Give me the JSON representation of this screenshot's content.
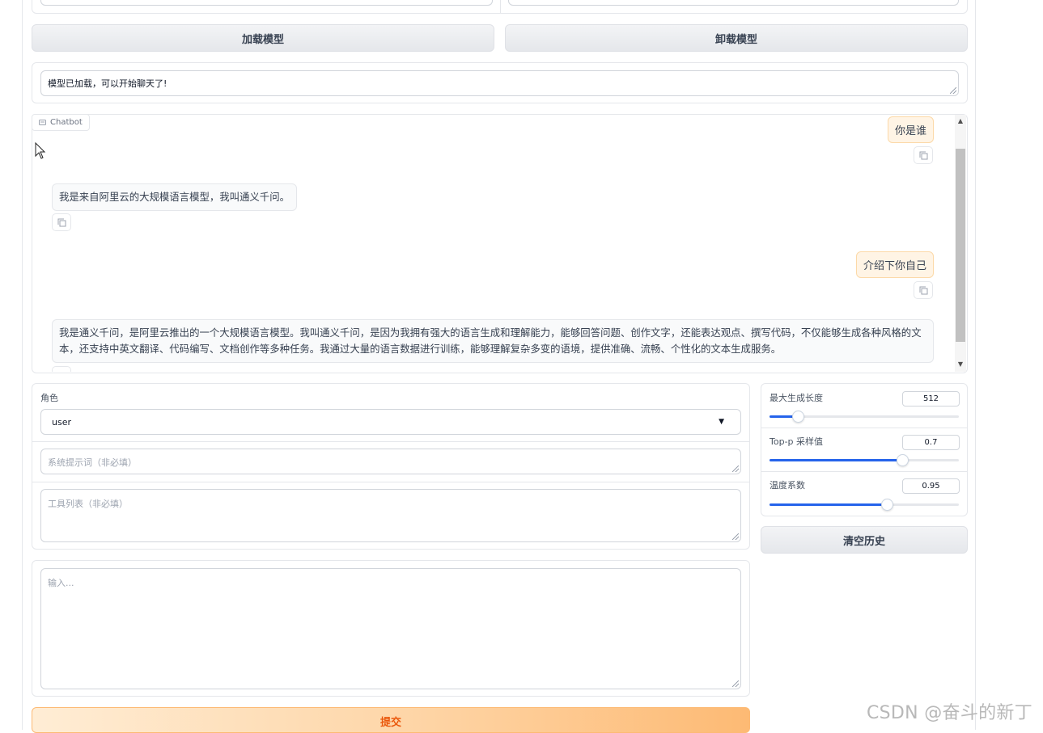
{
  "model_controls": {
    "load_button": "加载模型",
    "unload_button": "卸载模型",
    "status_text": "模型已加载，可以开始聊天了!"
  },
  "chatbot": {
    "label": "Chatbot",
    "messages": [
      {
        "role": "user",
        "text": "你是谁"
      },
      {
        "role": "assistant",
        "text": "我是来自阿里云的大规模语言模型，我叫通义千问。"
      },
      {
        "role": "user",
        "text": "介绍下你自己"
      },
      {
        "role": "assistant",
        "text": "我是通义千问，是阿里云推出的一个大规模语言模型。我叫通义千问，是因为我拥有强大的语言生成和理解能力，能够回答问题、创作文字，还能表达观点、撰写代码，不仅能够生成各种风格的文本，还支持中英文翻译、代码编写、文档创作等多种任务。我通过大量的语言数据进行训练，能够理解复杂多变的语境，提供准确、流畅、个性化的文本生成服务。"
      }
    ]
  },
  "role": {
    "label": "角色",
    "value": "user"
  },
  "system_prompt": {
    "placeholder": "系统提示词（非必填）"
  },
  "tools": {
    "placeholder": "工具列表（非必填）"
  },
  "input": {
    "placeholder": "输入..."
  },
  "submit_button": "提交",
  "params": {
    "max_length": {
      "label": "最大生成长度",
      "value": "512",
      "fraction": 0.15
    },
    "top_p": {
      "label": "Top-p 采样值",
      "value": "0.7",
      "fraction": 0.7
    },
    "temperature": {
      "label": "温度系数",
      "value": "0.95",
      "fraction": 0.62
    }
  },
  "clear_button": "清空历史",
  "watermark": "CSDN @奋斗的新丁"
}
